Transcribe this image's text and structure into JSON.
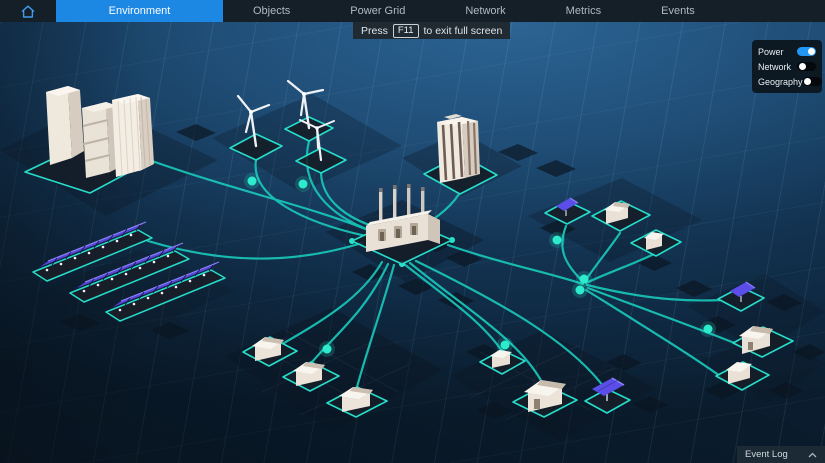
{
  "nav": {
    "home_icon": "home-icon",
    "tabs": [
      {
        "label": "Environment",
        "active": true
      },
      {
        "label": "Objects",
        "active": false
      },
      {
        "label": "Power Grid",
        "active": false
      },
      {
        "label": "Network",
        "active": false
      },
      {
        "label": "Metrics",
        "active": false
      },
      {
        "label": "Events",
        "active": false
      }
    ]
  },
  "toast": {
    "prefix": "Press",
    "key": "F11",
    "suffix": "to exit full screen"
  },
  "layers_panel": {
    "items": [
      {
        "label": "Power",
        "enabled": true
      },
      {
        "label": "Network",
        "enabled": false
      },
      {
        "label": "Geography",
        "enabled": false
      }
    ]
  },
  "event_log": {
    "label": "Event Log",
    "icon": "chevron-up-icon"
  },
  "colors": {
    "nav_bg": "#151f28",
    "active_tab": "#1d87e4",
    "scene_top": "#2e6899",
    "scene_bottom": "#0b1d2d",
    "link_teal": "#1cc5b8",
    "node_dot": "#2deccd",
    "tile_outline": "#27dcc9",
    "solar_panel": "#5a4de8",
    "building_cream": "#efe8dd",
    "toggle_on": "#2196f3"
  },
  "scene": {
    "view": "isometric-power-grid-twin",
    "hub": "power-plant",
    "sites": [
      {
        "name": "office-skyscrapers",
        "count": 3
      },
      {
        "name": "solar-farm-strips",
        "count": 3
      },
      {
        "name": "wind-turbines",
        "count": 3
      },
      {
        "name": "office-tower",
        "count": 1
      },
      {
        "name": "power-plant",
        "count": 1
      },
      {
        "name": "rooftop-solar-panels",
        "count": 3
      },
      {
        "name": "residential-houses",
        "count": 9
      }
    ]
  }
}
